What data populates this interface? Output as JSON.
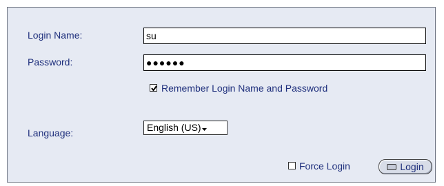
{
  "login_form": {
    "login_name_label": "Login Name:",
    "login_name_value": "su",
    "password_label": "Password:",
    "password_value": "●●●●●●",
    "remember_label": "Remember Login Name and Password",
    "remember_checked": true,
    "language_label": "Language:",
    "language_selected": "English (US)",
    "force_login_label": "Force Login",
    "force_login_checked": false,
    "login_button_label": "Login"
  },
  "colors": {
    "panel_bg": "#e6eaf3",
    "text": "#1e2f7c"
  }
}
